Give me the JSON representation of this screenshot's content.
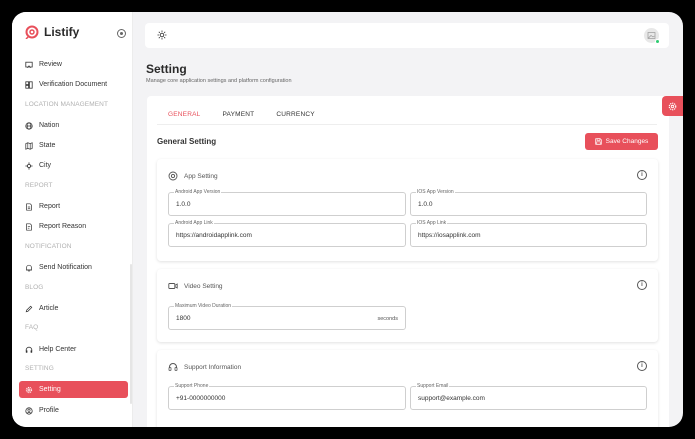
{
  "brand": {
    "name": "Listify"
  },
  "sidebar": {
    "items": [
      {
        "label": "Review",
        "icon": "review-icon"
      },
      {
        "label": "Verification Document",
        "icon": "document-icon"
      },
      {
        "section": "LOCATION MANAGEMENT"
      },
      {
        "label": "Nation",
        "icon": "globe-icon"
      },
      {
        "label": "State",
        "icon": "map-icon"
      },
      {
        "label": "City",
        "icon": "city-icon"
      },
      {
        "section": "REPORT"
      },
      {
        "label": "Report",
        "icon": "report-icon"
      },
      {
        "label": "Report Reason",
        "icon": "report-reason-icon"
      },
      {
        "section": "NOTIFICATION"
      },
      {
        "label": "Send Notification",
        "icon": "bell-icon"
      },
      {
        "section": "BLOG"
      },
      {
        "label": "Article",
        "icon": "pencil-icon"
      },
      {
        "section": "FAQ"
      },
      {
        "label": "Help Center",
        "icon": "headset-icon"
      },
      {
        "section": "SETTING"
      },
      {
        "label": "Setting",
        "icon": "gear-icon",
        "active": true
      },
      {
        "label": "Profile",
        "icon": "user-icon"
      }
    ]
  },
  "page": {
    "title": "Setting",
    "subtitle": "Manage core application settings and platform configuration"
  },
  "tabs": [
    {
      "label": "GENERAL",
      "active": true
    },
    {
      "label": "PAYMENT"
    },
    {
      "label": "CURRENCY"
    }
  ],
  "general": {
    "title": "General Setting",
    "save_label": "Save Changes"
  },
  "app_setting": {
    "title": "App Setting",
    "android_version_label": "Android App Version",
    "android_version": "1.0.0",
    "ios_version_label": "IOS App Version",
    "ios_version": "1.0.0",
    "android_link_label": "Android App Link",
    "android_link": "https://androidapplink.com",
    "ios_link_label": "IOS App Link",
    "ios_link": "https://iosapplink.com"
  },
  "video_setting": {
    "title": "Video Setting",
    "max_duration_label": "Maximum Video Duration",
    "max_duration": "1800",
    "max_duration_unit": "seconds"
  },
  "support_info": {
    "title": "Support Information",
    "phone_label": "Support Phone",
    "phone": "+91-0000000000",
    "email_label": "Support Email",
    "email": "support@example.com"
  },
  "colors": {
    "accent": "#e8505b",
    "online": "#2ecc71"
  }
}
